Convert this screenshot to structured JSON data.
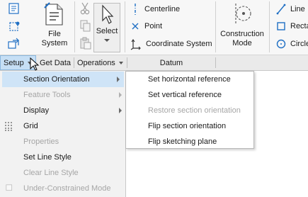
{
  "ribbon": {
    "file_system": {
      "line1": "File",
      "line2": "System"
    },
    "select": {
      "label": "Select"
    },
    "datum": {
      "centerline": "Centerline",
      "point": "Point",
      "coordinate_system": "Coordinate System"
    },
    "construction_mode": {
      "line1": "Construction",
      "line2": "Mode"
    },
    "sketch": {
      "line": "Line",
      "rectangle": "Recta",
      "circle": "Circle"
    }
  },
  "group_bar": {
    "setup": "Setup",
    "get_data": "Get Data",
    "operations": "Operations",
    "datum": "Datum"
  },
  "setup_menu": {
    "items": [
      {
        "label": "Section Orientation",
        "enabled": true,
        "submenu": true,
        "highlighted": true
      },
      {
        "label": "Feature Tools",
        "enabled": false,
        "submenu": true
      },
      {
        "label": "Display",
        "enabled": true,
        "submenu": true
      },
      {
        "label": "Grid",
        "enabled": true,
        "icon": "grid-icon"
      },
      {
        "label": "Properties",
        "enabled": false
      },
      {
        "label": "Set Line Style",
        "enabled": true
      },
      {
        "label": "Clear Line Style",
        "enabled": false
      },
      {
        "label": "Under-Constrained Mode",
        "enabled": false,
        "icon": "checkbox-icon"
      }
    ]
  },
  "section_orientation_submenu": {
    "items": [
      {
        "label": "Set horizontal reference",
        "enabled": true
      },
      {
        "label": "Set vertical reference",
        "enabled": true
      },
      {
        "label": "Restore section orientation",
        "enabled": false
      },
      {
        "label": "Flip section orientation",
        "enabled": true
      },
      {
        "label": "Flip sketching plane",
        "enabled": true
      }
    ]
  },
  "colors": {
    "icon_blue": "#1f6fc4",
    "highlight": "#cfe4f7",
    "tab_active": "#c6dff5"
  }
}
